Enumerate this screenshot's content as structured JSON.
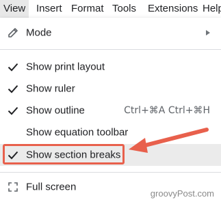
{
  "menubar": {
    "items": [
      "View",
      "Insert",
      "Format",
      "Tools",
      "Extensions",
      "Help"
    ]
  },
  "dropdown": {
    "mode": {
      "label": "Mode",
      "icon": "pencil-icon",
      "has_submenu": true
    },
    "show_print_layout": {
      "label": "Show print layout",
      "checked": true
    },
    "show_ruler": {
      "label": "Show ruler",
      "checked": true
    },
    "show_outline": {
      "label": "Show outline",
      "checked": true,
      "shortcut": "Ctrl+⌘A Ctrl+⌘H"
    },
    "show_equation_toolbar": {
      "label": "Show equation toolbar",
      "checked": false
    },
    "show_section_breaks": {
      "label": "Show section breaks",
      "checked": true,
      "highlighted": true
    },
    "full_screen": {
      "label": "Full screen",
      "icon": "fullscreen-icon"
    }
  },
  "annotation": {
    "color": "#e8604c"
  },
  "watermark": "groovyPost.com"
}
